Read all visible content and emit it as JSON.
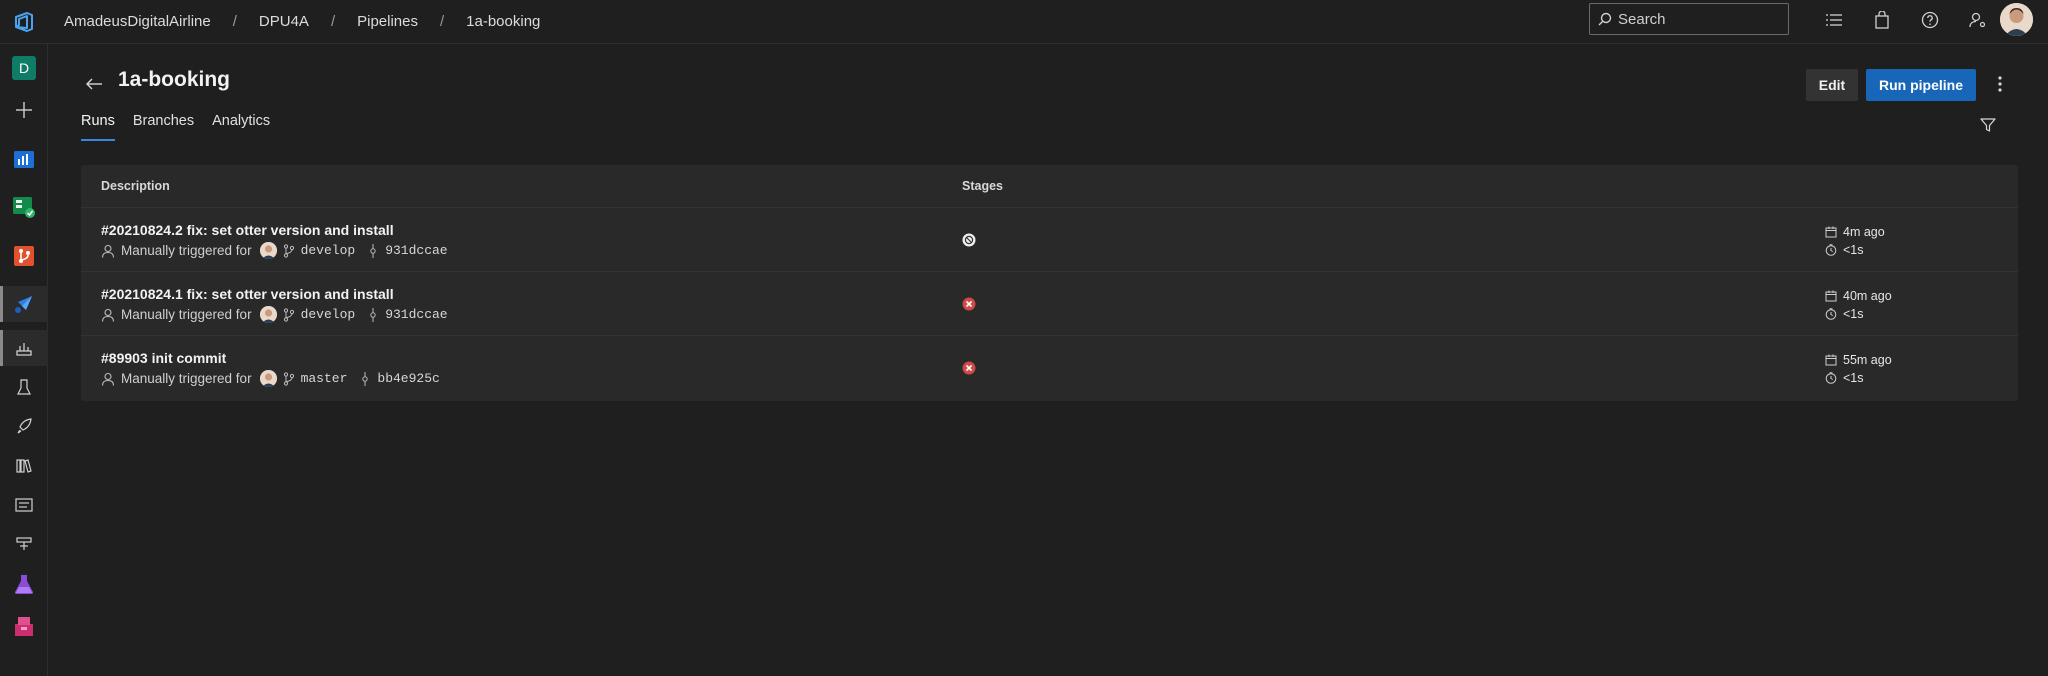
{
  "breadcrumb": [
    "AmadeusDigitalAirline",
    "DPU4A",
    "Pipelines",
    "1a-booking"
  ],
  "search": {
    "placeholder": "Search"
  },
  "rail": {
    "project_initial": "D"
  },
  "page": {
    "title": "1a-booking"
  },
  "actions": {
    "edit": "Edit",
    "run": "Run pipeline"
  },
  "tabs": [
    "Runs",
    "Branches",
    "Analytics"
  ],
  "table": {
    "headers": {
      "description": "Description",
      "stages": "Stages"
    },
    "rows": [
      {
        "title": "#20210824.2 fix: set otter version and install",
        "trigger": "Manually triggered for",
        "branch": "develop",
        "commit": "931dccae",
        "stage_status": "skipped",
        "ago": "4m ago",
        "duration": "<1s"
      },
      {
        "title": "#20210824.1 fix: set otter version and install",
        "trigger": "Manually triggered for",
        "branch": "develop",
        "commit": "931dccae",
        "stage_status": "failed",
        "ago": "40m ago",
        "duration": "<1s"
      },
      {
        "title": "#89903 init commit",
        "trigger": "Manually triggered for",
        "branch": "master",
        "commit": "bb4e925c",
        "stage_status": "failed",
        "ago": "55m ago",
        "duration": "<1s"
      }
    ]
  },
  "colors": {
    "accent": "#1766b7",
    "failed": "#cd4a45",
    "tab_underline": "#3a86d8"
  }
}
